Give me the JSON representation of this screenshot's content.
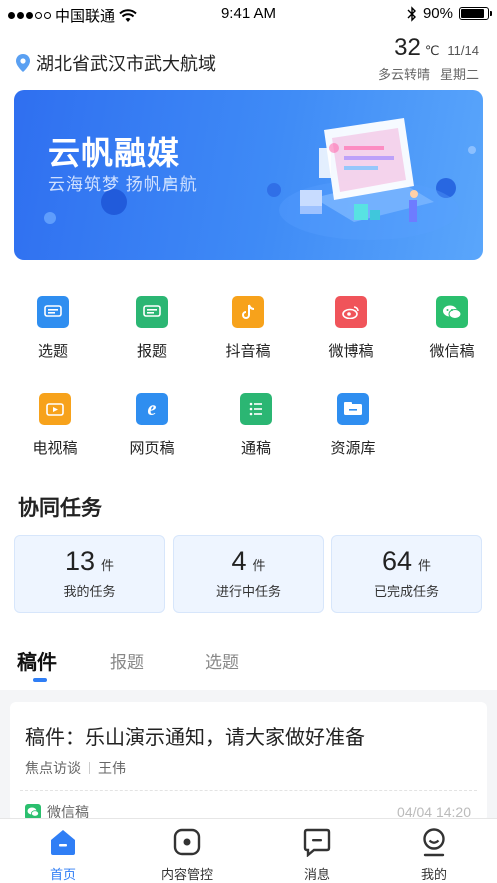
{
  "status_bar": {
    "carrier": "中国联通",
    "time": "9:41 AM",
    "battery": "90%",
    "battery_level": 0.9
  },
  "location": {
    "text": "湖北省武汉市武大航域"
  },
  "weather": {
    "temperature": "32",
    "unit": "℃",
    "date": "11/14",
    "condition": "多云转晴",
    "weekday": "星期二"
  },
  "banner": {
    "title": "云帆融媒",
    "subtitle": "云海筑梦  扬帆启航"
  },
  "functions": [
    {
      "label": "选题",
      "icon": "topic-icon",
      "color": "#2f8ef0"
    },
    {
      "label": "报题",
      "icon": "report-topic-icon",
      "color": "#2bb673"
    },
    {
      "label": "抖音稿",
      "icon": "douyin-icon",
      "color": "#f7a21b"
    },
    {
      "label": "微博稿",
      "icon": "weibo-icon",
      "color": "#f0545a"
    },
    {
      "label": "微信稿",
      "icon": "wechat-icon",
      "color": "#2bbf6e"
    },
    {
      "label": "电视稿",
      "icon": "tv-icon",
      "color": "#f7a21b"
    },
    {
      "label": "网页稿",
      "icon": "web-icon",
      "color": "#2f8ef0"
    },
    {
      "label": "通稿",
      "icon": "press-release-icon",
      "color": "#2bb673"
    },
    {
      "label": "资源库",
      "icon": "resource-library-icon",
      "color": "#2f8ef0"
    }
  ],
  "tasks": {
    "title": "协同任务",
    "cards": [
      {
        "count": "13",
        "unit": "件",
        "label": "我的任务"
      },
      {
        "count": "4",
        "unit": "件",
        "label": "进行中任务"
      },
      {
        "count": "64",
        "unit": "件",
        "label": "已完成任务"
      }
    ]
  },
  "tabs": [
    "稿件",
    "报题",
    "选题"
  ],
  "articles": [
    {
      "title": "稿件：乐山演示通知，请大家做好准备",
      "column": "焦点访谈",
      "author": "王伟",
      "type": "微信稿",
      "time": "04/04 14:20"
    }
  ],
  "bottom_nav": [
    {
      "label": "首页",
      "icon": "home-icon",
      "active": true
    },
    {
      "label": "内容管控",
      "icon": "content-control-icon",
      "active": false
    },
    {
      "label": "消息",
      "icon": "message-icon",
      "active": false
    },
    {
      "label": "我的",
      "icon": "profile-icon",
      "active": false
    }
  ],
  "colors": {
    "accent": "#2f7ef5",
    "card_bg": "#eef5ff"
  }
}
